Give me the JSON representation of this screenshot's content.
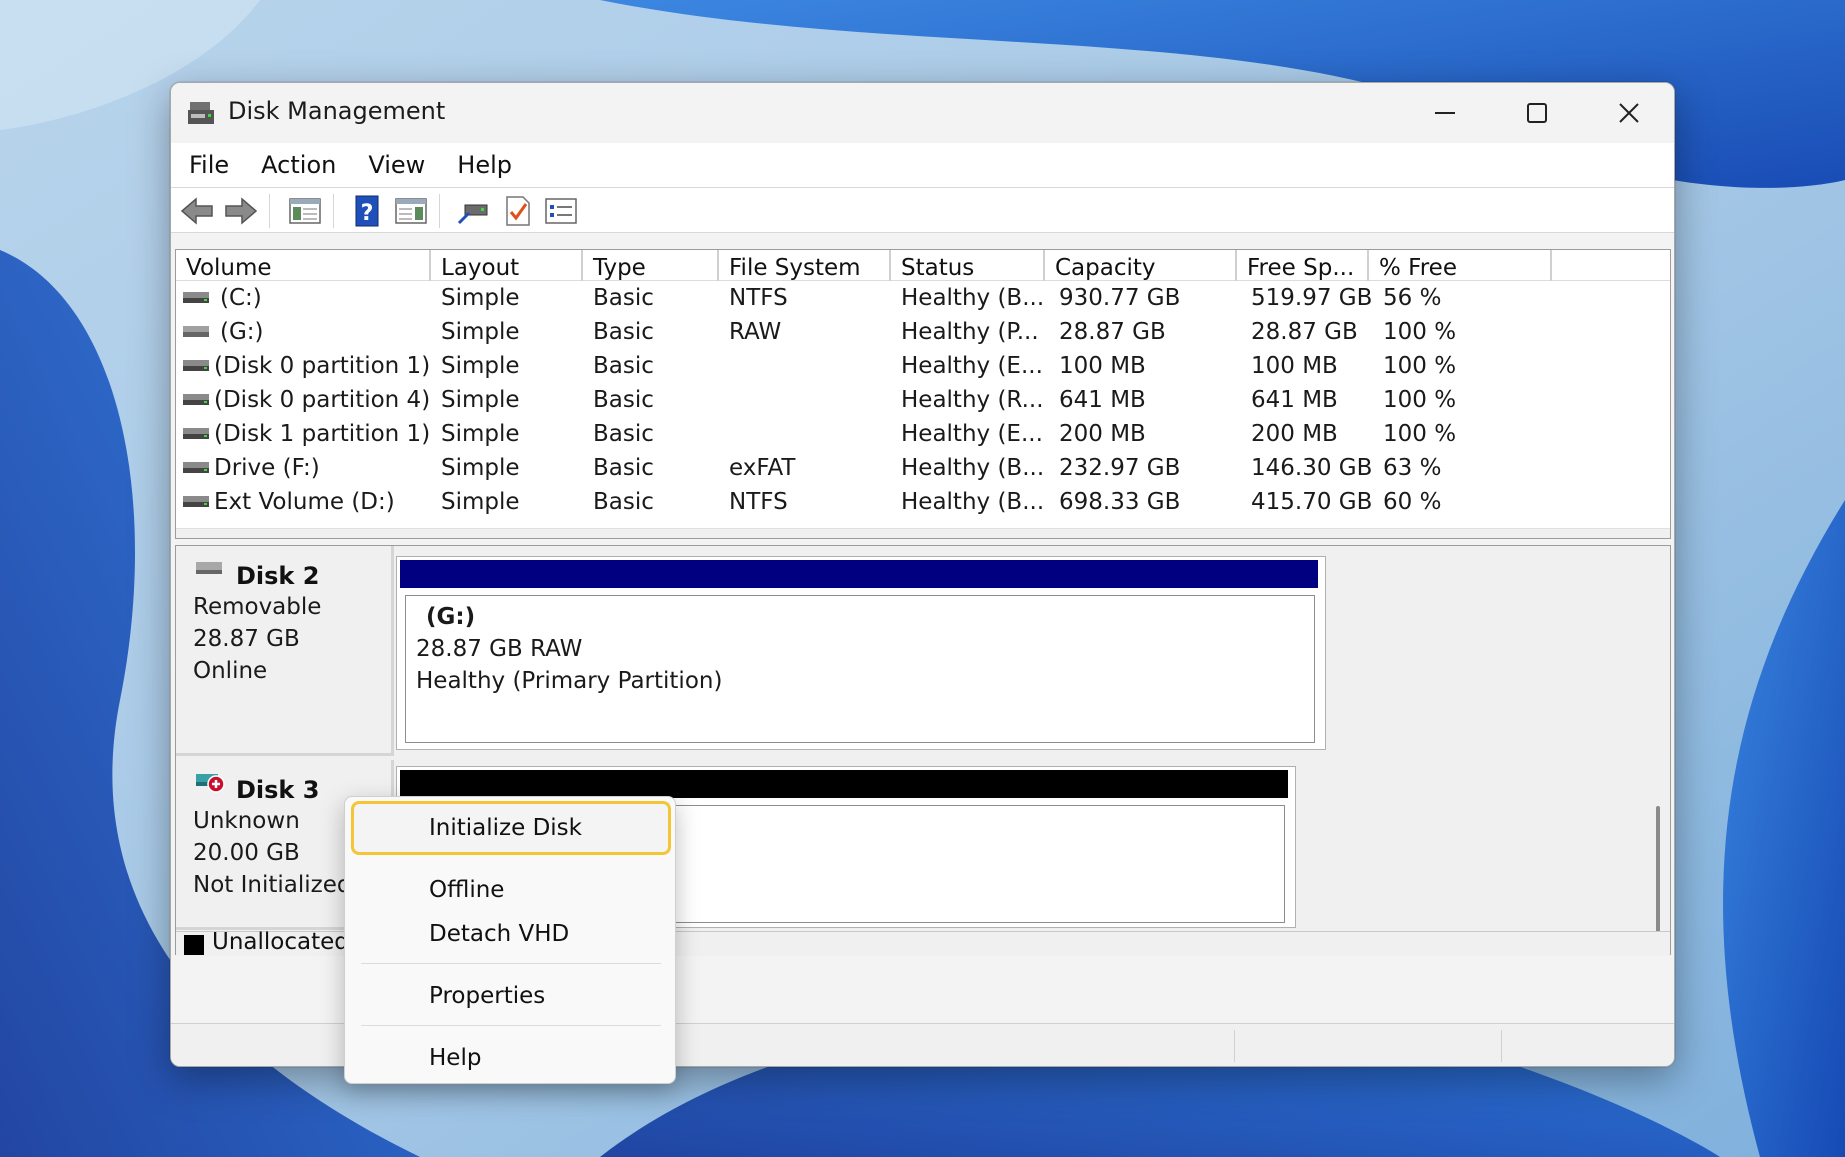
{
  "window": {
    "title": "Disk Management"
  },
  "menu": [
    "File",
    "Action",
    "View",
    "Help"
  ],
  "toolbar_icons": [
    "back-arrow-icon",
    "forward-arrow-icon",
    "show-hide-console-tree-icon",
    "help-icon",
    "show-hide-action-pane-icon",
    "connect-icon",
    "check-icon",
    "properties-icon"
  ],
  "volume_table": {
    "columns": [
      "Volume",
      "Layout",
      "Type",
      "File System",
      "Status",
      "Capacity",
      "Free Sp...",
      "% Free"
    ],
    "rows": [
      {
        "volume": "(C:)",
        "layout": "Simple",
        "type": "Basic",
        "fs": "NTFS",
        "status": "Healthy (B...",
        "capacity": "930.77 GB",
        "free": "519.97 GB",
        "pct": "56 %"
      },
      {
        "volume": "(G:)",
        "layout": "Simple",
        "type": "Basic",
        "fs": "RAW",
        "status": "Healthy (P...",
        "capacity": "28.87 GB",
        "free": "28.87 GB",
        "pct": "100 %"
      },
      {
        "volume": "(Disk 0 partition 1)",
        "layout": "Simple",
        "type": "Basic",
        "fs": "",
        "status": "Healthy (E...",
        "capacity": "100 MB",
        "free": "100 MB",
        "pct": "100 %"
      },
      {
        "volume": "(Disk 0 partition 4)",
        "layout": "Simple",
        "type": "Basic",
        "fs": "",
        "status": "Healthy (R...",
        "capacity": "641 MB",
        "free": "641 MB",
        "pct": "100 %"
      },
      {
        "volume": "(Disk 1 partition 1)",
        "layout": "Simple",
        "type": "Basic",
        "fs": "",
        "status": "Healthy (E...",
        "capacity": "200 MB",
        "free": "200 MB",
        "pct": "100 %"
      },
      {
        "volume": "Drive (F:)",
        "layout": "Simple",
        "type": "Basic",
        "fs": "exFAT",
        "status": "Healthy (B...",
        "capacity": "232.97 GB",
        "free": "146.30 GB",
        "pct": "63 %"
      },
      {
        "volume": "Ext Volume (D:)",
        "layout": "Simple",
        "type": "Basic",
        "fs": "NTFS",
        "status": "Healthy (B...",
        "capacity": "698.33 GB",
        "free": "415.70 GB",
        "pct": "60 %"
      }
    ]
  },
  "disks": [
    {
      "name": "Disk 2",
      "kind": "Removable",
      "size": "28.87 GB",
      "state": "Online",
      "partition": {
        "title": "(G:)",
        "line1": "28.87 GB RAW",
        "line2": "Healthy (Primary Partition)",
        "bar_color": "#000080"
      }
    },
    {
      "name": "Disk 3",
      "kind": "Unknown",
      "size": "20.00 GB",
      "state": "Not Initialized",
      "partition": {
        "bar_color": "#000000"
      }
    }
  ],
  "legend": {
    "label": "Unallocated",
    "color": "#000000"
  },
  "context_menu": {
    "items": [
      "Initialize Disk",
      "Offline",
      "Detach VHD",
      "Properties",
      "Help"
    ],
    "highlighted": "Initialize Disk",
    "highlight_color": "#f3c537"
  }
}
